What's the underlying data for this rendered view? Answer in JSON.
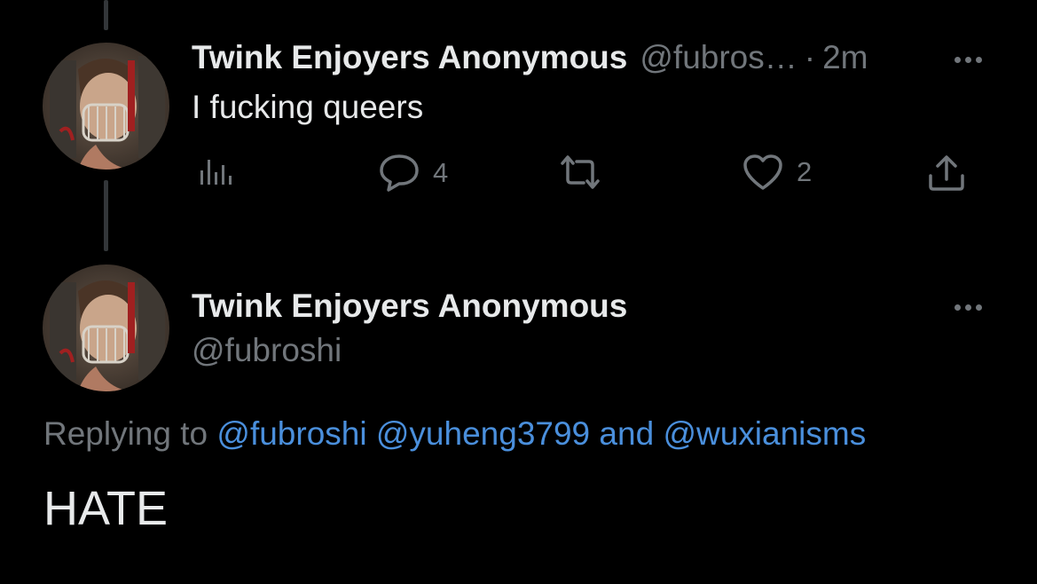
{
  "tweet": {
    "author_name": "Twink Enjoyers Anonymous",
    "author_handle": "@fubros…",
    "separator": "·",
    "time": "2m",
    "text": "I fucking queers",
    "actions": {
      "views_icon": "bar-chart-icon",
      "reply_icon": "speech-bubble-icon",
      "reply_count": "4",
      "retweet_icon": "retweet-icon",
      "like_icon": "heart-icon",
      "like_count": "2",
      "share_icon": "share-icon"
    }
  },
  "reply": {
    "author_name": "Twink Enjoyers Anonymous",
    "author_handle": "@fubroshi",
    "replying_prefix": "Replying to",
    "mention_1": "@fubroshi",
    "mention_2": "@yuheng3799",
    "conjunction": "and",
    "mention_3": "@wuxianisms",
    "text": "HATE"
  },
  "colors": {
    "background": "#000000",
    "primary_text": "#e7e9ea",
    "secondary_text": "#71767b",
    "link": "#4a8fdc",
    "thread_line": "#333639"
  }
}
